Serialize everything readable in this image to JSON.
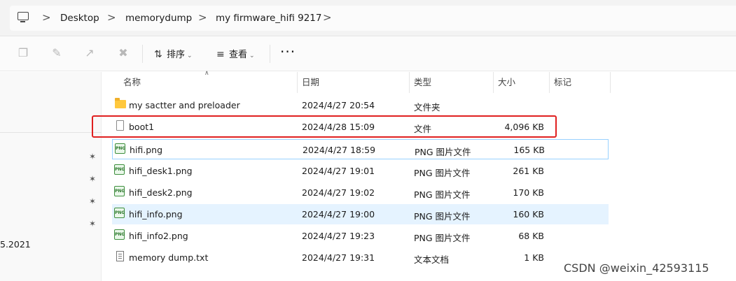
{
  "breadcrumb": {
    "items": [
      "Desktop",
      "memorydump",
      "my firmware_hifi 9217"
    ],
    "separator": ">"
  },
  "toolbar": {
    "sort_label": "排序",
    "view_label": "查看",
    "more_label": "···",
    "dropdown_caret": "⌄",
    "icons": [
      "copy-icon",
      "rename-icon",
      "share-icon",
      "delete-icon",
      "sort-icon",
      "view-icon",
      "more-icon"
    ]
  },
  "nav": {
    "visible_text": "5.2021"
  },
  "columns": {
    "name": "名称",
    "date": "日期",
    "type": "类型",
    "size": "大小",
    "tags": "标记"
  },
  "files": [
    {
      "name": "my sactter and preloader",
      "date": "2024/4/27 20:54",
      "type": "文件夹",
      "size": "",
      "icon": "folder-icon"
    },
    {
      "name": "boot1",
      "date": "2024/4/28 15:09",
      "type": "文件",
      "size": "4,096 KB",
      "icon": "file-icon"
    },
    {
      "name": "hifi.png",
      "date": "2024/4/27 18:59",
      "type": "PNG 图片文件",
      "size": "165 KB",
      "icon": "png-icon"
    },
    {
      "name": "hifi_desk1.png",
      "date": "2024/4/27 19:01",
      "type": "PNG 图片文件",
      "size": "261 KB",
      "icon": "png-icon"
    },
    {
      "name": "hifi_desk2.png",
      "date": "2024/4/27 19:02",
      "type": "PNG 图片文件",
      "size": "170 KB",
      "icon": "png-icon"
    },
    {
      "name": "hifi_info.png",
      "date": "2024/4/27 19:00",
      "type": "PNG 图片文件",
      "size": "160 KB",
      "icon": "png-icon"
    },
    {
      "name": "hifi_info2.png",
      "date": "2024/4/27 19:23",
      "type": "PNG 图片文件",
      "size": "68 KB",
      "icon": "png-icon"
    },
    {
      "name": "memory dump.txt",
      "date": "2024/4/27 19:31",
      "type": "文本文档",
      "size": "1 KB",
      "icon": "txt-icon"
    }
  ],
  "png_icon_text": "PNG",
  "watermark": "CSDN @weixin_42593115",
  "colors": {
    "selection": "#e5f3ff",
    "focus_border": "#99d1ff",
    "annotation_red": "#e02020",
    "folder": "#ffc83d"
  }
}
